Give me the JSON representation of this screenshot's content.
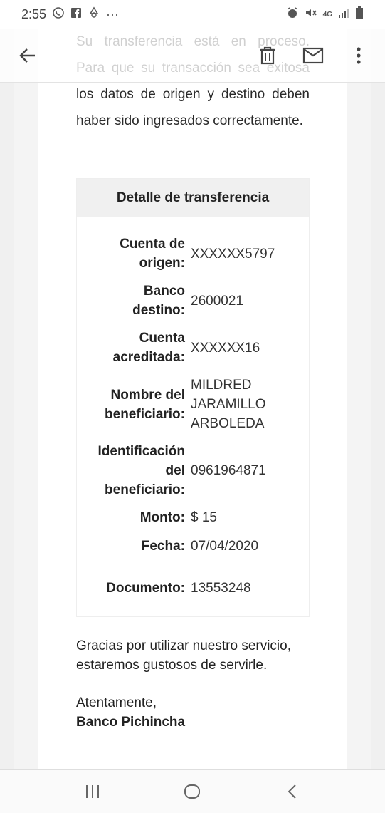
{
  "status_bar": {
    "time": "2:55",
    "more": "···",
    "network": "4G"
  },
  "app_bar": {
    "back_icon": "arrow-left-icon",
    "delete_icon": "trash-icon",
    "mail_icon": "envelope-icon",
    "more_icon": "more-vertical-icon"
  },
  "intro": "Su transferencia está en proceso. Para que su transacción sea exitosa los datos de origen y destino deben haber sido ingresados correctamente.",
  "detail": {
    "title": "Detalle de transferencia",
    "rows": [
      {
        "label_lines": [
          "Cuenta de",
          "origen:"
        ],
        "value_lines": [
          "XXXXXX5797"
        ]
      },
      {
        "label_lines": [
          "Banco",
          "destino:"
        ],
        "value_lines": [
          "2600021"
        ]
      },
      {
        "label_lines": [
          "Cuenta",
          "acreditada:"
        ],
        "value_lines": [
          "XXXXXX16"
        ]
      },
      {
        "label_lines": [
          "Nombre del",
          "beneficiario:"
        ],
        "value_lines": [
          "MILDRED",
          "JARAMILLO",
          "ARBOLEDA"
        ]
      },
      {
        "label_lines": [
          "Identificación",
          "del",
          "beneficiario:"
        ],
        "value_lines": [
          "0961964871"
        ]
      },
      {
        "label_lines": [
          "Monto:"
        ],
        "value_lines": [
          "$ 15"
        ]
      },
      {
        "label_lines": [
          "Fecha:"
        ],
        "value_lines": [
          "07/04/2020"
        ]
      },
      {
        "label_lines": [
          "Documento:"
        ],
        "value_lines": [
          "13553248"
        ]
      }
    ]
  },
  "closing_lines": [
    "Gracias por utilizar nuestro servicio,",
    "estaremos gustosos de servirle."
  ],
  "regards": "Atentamente,",
  "bank_name": "Banco Pichincha"
}
